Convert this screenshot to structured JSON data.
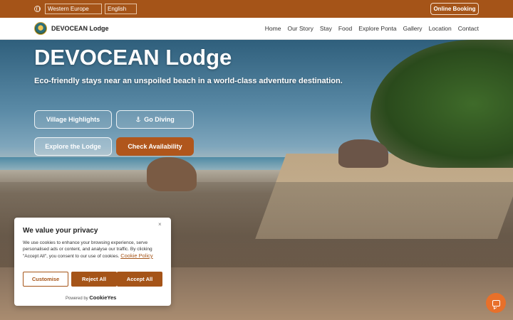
{
  "topbar": {
    "region": "Western Europe",
    "language": "English",
    "booking_label": "Online Booking"
  },
  "navbar": {
    "brand": "DEVOCEAN Lodge",
    "items": [
      "Home",
      "Our Story",
      "Stay",
      "Food",
      "Explore Ponta",
      "Gallery",
      "Location",
      "Contact"
    ]
  },
  "hero": {
    "title": "DEVOCEAN Lodge",
    "subtitle": "Eco-friendly stays near an unspoiled beach in a world-class adventure destination.",
    "buttons": {
      "village": "Village Highlights",
      "diving": "Go Diving",
      "explore": "Explore the Lodge",
      "availability": "Check Availability"
    }
  },
  "cookie": {
    "title": "We value your privacy",
    "close": "×",
    "text": "We use cookies to enhance your browsing experience, serve personalised ads or content, and analyse our traffic. By clicking \"Accept All\", you consent to our use of cookies.",
    "policy_link": "Cookie Policy",
    "customise": "Customise",
    "reject": "Reject All",
    "accept": "Accept All",
    "powered_by": "Powered by",
    "provider": "CookieYes"
  },
  "colors": {
    "brand": "#a55418",
    "accent": "#e8702a"
  },
  "icons": [
    "globe-icon",
    "anchor-icon",
    "close-icon",
    "chat-icon"
  ]
}
